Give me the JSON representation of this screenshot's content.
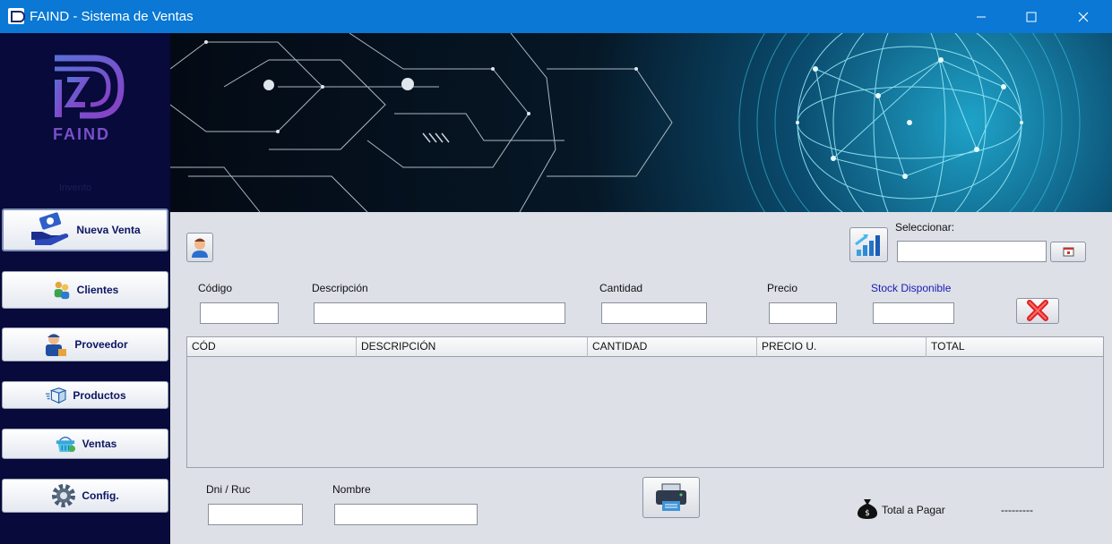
{
  "window": {
    "title": "FAIND - Sistema de Ventas"
  },
  "sidebar": {
    "brand": "FAIND",
    "subtitle": "Invento",
    "items": [
      {
        "label": "Nueva Venta",
        "icon": "money-hand-icon",
        "active": true
      },
      {
        "label": "Clientes",
        "icon": "customers-icon"
      },
      {
        "label": "Proveedor",
        "icon": "supplier-icon"
      },
      {
        "label": "Productos",
        "icon": "box-icon"
      },
      {
        "label": "Ventas",
        "icon": "shopping-basket-icon"
      },
      {
        "label": "Config.",
        "icon": "gear-icon"
      }
    ]
  },
  "form": {
    "seleccionar_label": "Seleccionar:",
    "codigo_label": "Código",
    "descripcion_label": "Descripción",
    "cantidad_label": "Cantidad",
    "precio_label": "Precio",
    "stock_label": "Stock Disponible",
    "dni_label": "Dni / Ruc",
    "nombre_label": "Nombre",
    "codigo_value": "",
    "descripcion_value": "",
    "cantidad_value": "",
    "precio_value": "",
    "stock_value": "",
    "dni_value": "",
    "nombre_value": "",
    "seleccionar_value": ""
  },
  "table": {
    "columns": [
      "CÓD",
      "DESCRIPCIÓN",
      "CANTIDAD",
      "PRECIO U.",
      "TOTAL"
    ],
    "rows": []
  },
  "footer": {
    "total_label": "Total a Pagar",
    "total_value": "---------"
  },
  "colors": {
    "titlebar": "#0a78d4",
    "sidebar": "#070a3a",
    "panel": "#dde0e7",
    "stock_label": "#1a1ab4"
  }
}
